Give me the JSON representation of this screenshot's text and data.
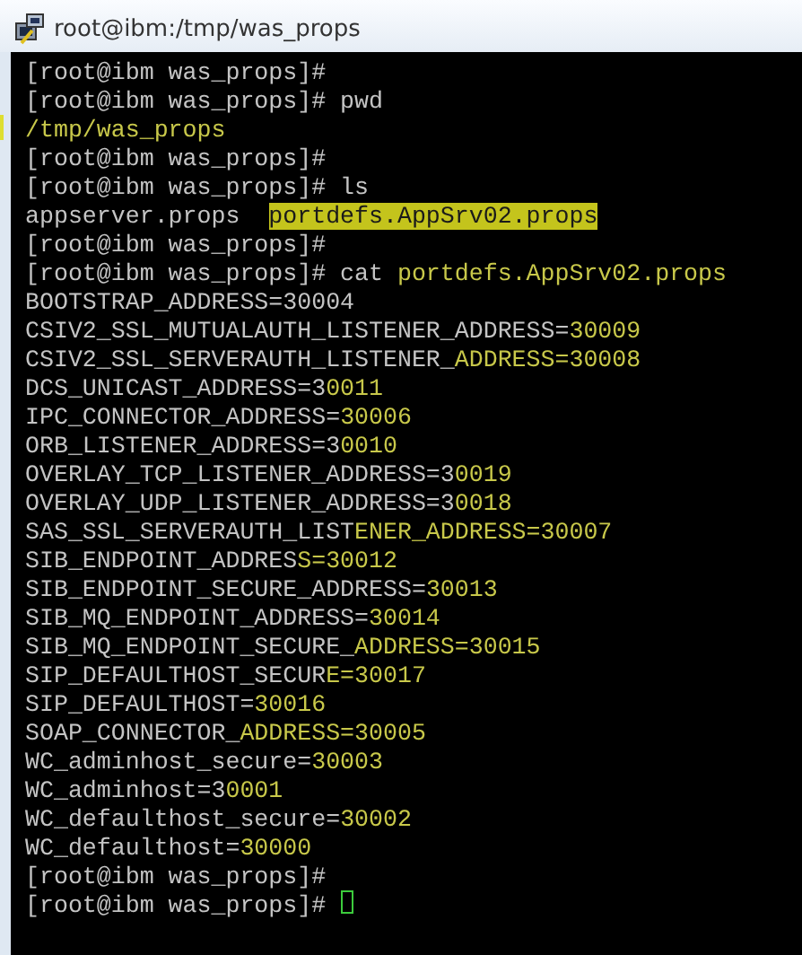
{
  "window": {
    "title": "root@ibm:/tmp/was_props"
  },
  "terminal": {
    "lines": [
      {
        "kind": "plain",
        "text": "[root@ibm was_props]#"
      },
      {
        "kind": "plain",
        "text": "[root@ibm was_props]# pwd"
      },
      {
        "kind": "marked",
        "tail": "/tmp/was_props"
      },
      {
        "kind": "plain",
        "text": "[root@ibm was_props]#"
      },
      {
        "kind": "plain",
        "text": "[root@ibm was_props]# ls"
      },
      {
        "kind": "selection",
        "text": "appserver.props  ",
        "tail": "portdefs.AppSrv02.props"
      },
      {
        "kind": "plain",
        "text": "[root@ibm was_props]#"
      },
      {
        "kind": "tinted",
        "text": "[root@ibm was_props]# cat ",
        "tail": "portdefs.AppSrv02.props"
      },
      {
        "kind": "plain",
        "text": "BOOTSTRAP_ADDRESS=30004"
      },
      {
        "kind": "tinted",
        "text": "CSIV2_SSL_MUTUALAUTH_LISTENER_ADDRESS=",
        "tail": "30009"
      },
      {
        "kind": "tinted",
        "text": "CSIV2_SSL_SERVERAUTH_LISTENER_",
        "tail": "ADDRESS=30008"
      },
      {
        "kind": "tinted",
        "text": "DCS_UNICAST_ADDRESS=3",
        "tail": "0011"
      },
      {
        "kind": "tinted",
        "text": "IPC_CONNECTOR_ADDRESS=",
        "tail": "30006"
      },
      {
        "kind": "tinted",
        "text": "ORB_LISTENER_ADDRESS=3",
        "tail": "0010"
      },
      {
        "kind": "tinted",
        "text": "OVERLAY_TCP_LISTENER_ADDRESS=3",
        "tail": "0019"
      },
      {
        "kind": "tinted",
        "text": "OVERLAY_UDP_LISTENER_ADDRESS=3",
        "tail": "0018"
      },
      {
        "kind": "tinted",
        "text": "SAS_SSL_SERVERAUTH_LIST",
        "tail": "ENER_ADDRESS=30007"
      },
      {
        "kind": "tinted",
        "text": "SIB_ENDPOINT_ADDRES",
        "tail": "S=30012"
      },
      {
        "kind": "tinted",
        "text": "SIB_ENDPOINT_SECURE_ADDRESS=",
        "tail": "30013"
      },
      {
        "kind": "tinted",
        "text": "SIB_MQ_ENDPOINT_ADDRESS=",
        "tail": "30014"
      },
      {
        "kind": "tinted",
        "text": "SIB_MQ_ENDPOINT_SECURE_",
        "tail": "ADDRESS=30015"
      },
      {
        "kind": "tinted",
        "text": "SIP_DEFAULTHOST_SECUR",
        "tail": "E=30017"
      },
      {
        "kind": "tinted",
        "text": "SIP_DEFAULTHOST=",
        "tail": "30016"
      },
      {
        "kind": "tinted",
        "text": "SOAP_CONNECTOR_",
        "tail": "ADDRESS=30005"
      },
      {
        "kind": "tinted",
        "text": "WC_adminhost_secure=",
        "tail": "30003"
      },
      {
        "kind": "tinted",
        "text": "WC_adminhost=3",
        "tail": "0001"
      },
      {
        "kind": "tinted",
        "text": "WC_defaulthost_secure=",
        "tail": "30002"
      },
      {
        "kind": "tinted",
        "text": "WC_defaulthost=",
        "tail": "30000"
      },
      {
        "kind": "plain",
        "text": "[root@ibm was_props]#"
      },
      {
        "kind": "input",
        "text": "[root@ibm was_props]# "
      }
    ]
  }
}
